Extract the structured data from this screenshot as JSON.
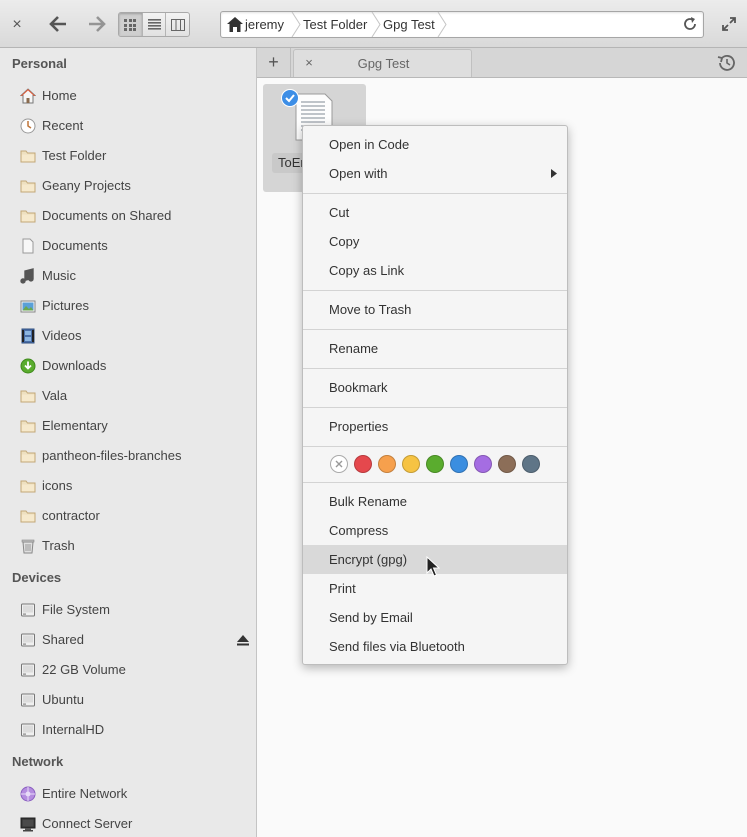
{
  "breadcrumbs": [
    "jeremy",
    "Test Folder",
    "Gpg Test"
  ],
  "tabs": {
    "new_tab_label": "+",
    "tab_title": "Gpg Test",
    "tab_close": "×"
  },
  "window": {
    "close": "×"
  },
  "sidebar": {
    "personal_heading": "Personal",
    "personal": [
      {
        "label": "Home",
        "icon": "home-icon"
      },
      {
        "label": "Recent",
        "icon": "recent-icon"
      },
      {
        "label": "Test Folder",
        "icon": "folder-icon"
      },
      {
        "label": "Geany Projects",
        "icon": "folder-icon"
      },
      {
        "label": "Documents on Shared",
        "icon": "folder-icon"
      },
      {
        "label": "Documents",
        "icon": "document-icon"
      },
      {
        "label": "Music",
        "icon": "music-icon"
      },
      {
        "label": "Pictures",
        "icon": "pictures-icon"
      },
      {
        "label": "Videos",
        "icon": "videos-icon"
      },
      {
        "label": "Downloads",
        "icon": "downloads-icon"
      },
      {
        "label": "Vala",
        "icon": "folder-icon"
      },
      {
        "label": "Elementary",
        "icon": "folder-icon"
      },
      {
        "label": "pantheon-files-branches",
        "icon": "folder-icon"
      },
      {
        "label": "icons",
        "icon": "folder-icon"
      },
      {
        "label": "contractor",
        "icon": "folder-icon"
      },
      {
        "label": "Trash",
        "icon": "trash-icon"
      }
    ],
    "devices_heading": "Devices",
    "devices": [
      {
        "label": "File System",
        "icon": "drive-icon"
      },
      {
        "label": "Shared",
        "icon": "drive-icon"
      },
      {
        "label": "22 GB Volume",
        "icon": "drive-icon"
      },
      {
        "label": "Ubuntu",
        "icon": "drive-icon"
      },
      {
        "label": "InternalHD",
        "icon": "drive-icon"
      }
    ],
    "network_heading": "Network",
    "network": [
      {
        "label": "Entire Network",
        "icon": "network-icon"
      },
      {
        "label": "Connect Server",
        "icon": "server-icon"
      }
    ]
  },
  "file": {
    "label": "ToEr"
  },
  "context_menu": {
    "items": [
      "Open in Code",
      "Open with",
      "Cut",
      "Copy",
      "Copy as Link",
      "Move to Trash",
      "Rename",
      "Bookmark",
      "Properties",
      "Bulk Rename",
      "Compress",
      "Encrypt (gpg)",
      "Print",
      "Send by Email",
      "Send files via Bluetooth"
    ],
    "hovered_item": "Encrypt (gpg)",
    "tag_colors": [
      "#e5484d",
      "#f6a04d",
      "#f6c343",
      "#5aac2e",
      "#3b8ee0",
      "#a56de2",
      "#8c6e58",
      "#5f7587"
    ]
  }
}
